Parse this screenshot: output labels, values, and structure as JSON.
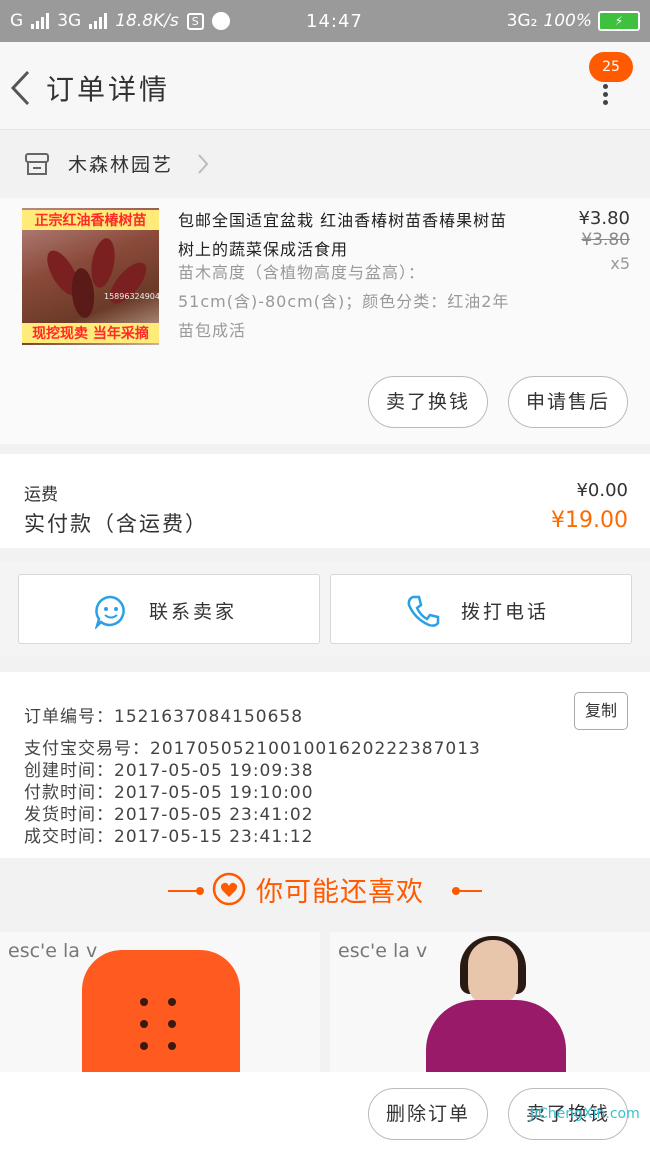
{
  "status": {
    "left": "G",
    "net": "3G",
    "speed": "18.8K/s",
    "s_box": "S",
    "time": "14:47",
    "net2": "3G₂",
    "battery": "100%",
    "battery_color": "#3ec13e"
  },
  "nav": {
    "title": "订单详情",
    "badge": "25"
  },
  "store": {
    "name": "木森林园艺"
  },
  "product": {
    "thumb_top": "正宗红油香椿树苗",
    "thumb_bottom": "现挖现卖 当年采摘",
    "thumb_phone": "15896324904",
    "name": "包邮全国适宜盆栽 红油香椿树苗香椿果树苗树上的蔬菜保成活食用",
    "spec": "苗木高度（含植物高度与盆高）：51cm(含)-80cm(含)；颜色分类：红油2年苗包成活",
    "price": "¥3.80",
    "original_price": "¥3.80",
    "qty": "x5",
    "btn_sold": "卖了换钱",
    "btn_service": "申请售后"
  },
  "fee": {
    "shipping_label": "运费",
    "shipping_value": "¥0.00",
    "paid_label": "实付款（含运费）",
    "paid_value": "¥19.00",
    "accent": "#ff6a00"
  },
  "contact": {
    "seller": "联系卖家",
    "phone": "拨打电话"
  },
  "info": {
    "order_no": "订单编号：1521637084150658",
    "copy": "复制",
    "alipay": "支付宝交易号：2017050521001001620222387013",
    "created": "创建时间：2017-05-05 19:09:38",
    "paid": "付款时间：2017-05-05 19:10:00",
    "shipped": "发货时间：2017-05-05 23:41:02",
    "done": "成交时间：2017-05-15 23:41:12"
  },
  "recommend": {
    "title": "你可能还喜欢",
    "items": [
      {
        "brand": "esc'e la v"
      },
      {
        "brand": "esc'e la v"
      }
    ]
  },
  "bottom": {
    "delete": "删除订单",
    "sell": "卖了换钱",
    "watermark": "JiChengXin.com"
  }
}
